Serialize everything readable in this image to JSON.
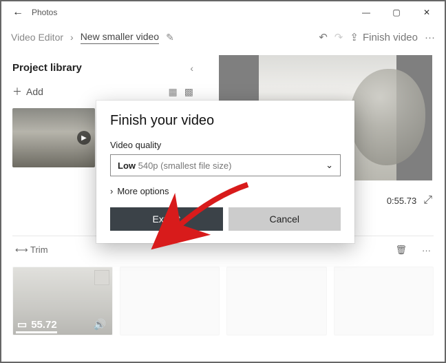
{
  "titlebar": {
    "app_name": "Photos"
  },
  "subheader": {
    "crumb1": "Video Editor",
    "project_name": "New smaller video",
    "finish_label": "Finish video"
  },
  "library": {
    "heading": "Project library",
    "add_label": "Add"
  },
  "preview": {
    "time_current": "0:55.73"
  },
  "toolbar": {
    "trim_label": "Trim"
  },
  "clips": {
    "duration": "55.72"
  },
  "dialog": {
    "title": "Finish your video",
    "quality_label": "Video quality",
    "quality_value_bold": "Low",
    "quality_value_rest": " 540p (smallest file size)",
    "more_label": "More options",
    "export_label": "Export",
    "cancel_label": "Cancel"
  }
}
